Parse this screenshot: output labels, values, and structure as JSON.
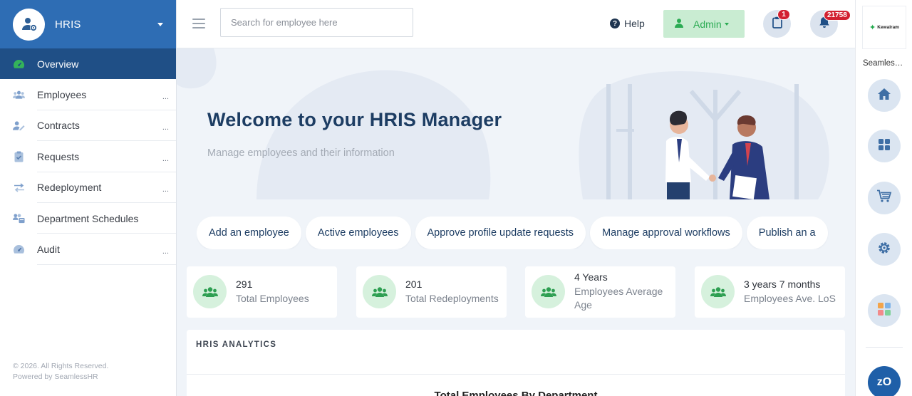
{
  "sidebar": {
    "app_title": "HRIS",
    "items": [
      {
        "label": "Overview",
        "active": true,
        "icon": "dashboard-icon",
        "more": ""
      },
      {
        "label": "Employees",
        "active": false,
        "icon": "users-icon",
        "more": "..."
      },
      {
        "label": "Contracts",
        "active": false,
        "icon": "user-edit-icon",
        "more": "..."
      },
      {
        "label": "Requests",
        "active": false,
        "icon": "clipboard-check-icon",
        "more": "..."
      },
      {
        "label": "Redeployment",
        "active": false,
        "icon": "exchange-icon",
        "more": "..."
      },
      {
        "label": "Department Schedules",
        "active": false,
        "icon": "calendar-users-icon",
        "more": ""
      },
      {
        "label": "Audit",
        "active": false,
        "icon": "gauge-icon",
        "more": "..."
      }
    ],
    "footer_copyright": "© 2026. All Rights Reserved.",
    "footer_powered": "Powered by SeamlessHR"
  },
  "topbar": {
    "search_placeholder": "Search for employee here",
    "help_label": "Help",
    "admin_label": "Admin",
    "clipboard_badge": "1",
    "notifications_badge": "21758"
  },
  "rail": {
    "brand_wordmark": "Kewalram",
    "company_name": "Seamless...",
    "buttons": [
      "home-icon",
      "apps-grid-icon",
      "cart-icon",
      "settings-gear-icon",
      "color-grid-icon"
    ],
    "zo_label": "zO"
  },
  "hero": {
    "title": "Welcome to your HRIS Manager",
    "subtitle": "Manage employees and their information"
  },
  "quick_actions": [
    "Add an employee",
    "Active employees",
    "Approve profile update requests",
    "Manage approval workflows",
    "Publish an a"
  ],
  "stats": [
    {
      "value": "291",
      "label": "Total Employees"
    },
    {
      "value": "201",
      "label": "Total Redeployments"
    },
    {
      "value": "4 Years",
      "label": "Employees Average Age"
    },
    {
      "value": "3 years 7 months",
      "label": "Employees Ave. LoS"
    }
  ],
  "analytics": {
    "heading": "HRIS ANALYTICS",
    "chart_title": "Total Employees By Department"
  },
  "colors": {
    "primary": "#2e6db4",
    "active_nav": "#1f4f86",
    "admin_green": "#2bab53",
    "badge_red": "#d22030"
  }
}
